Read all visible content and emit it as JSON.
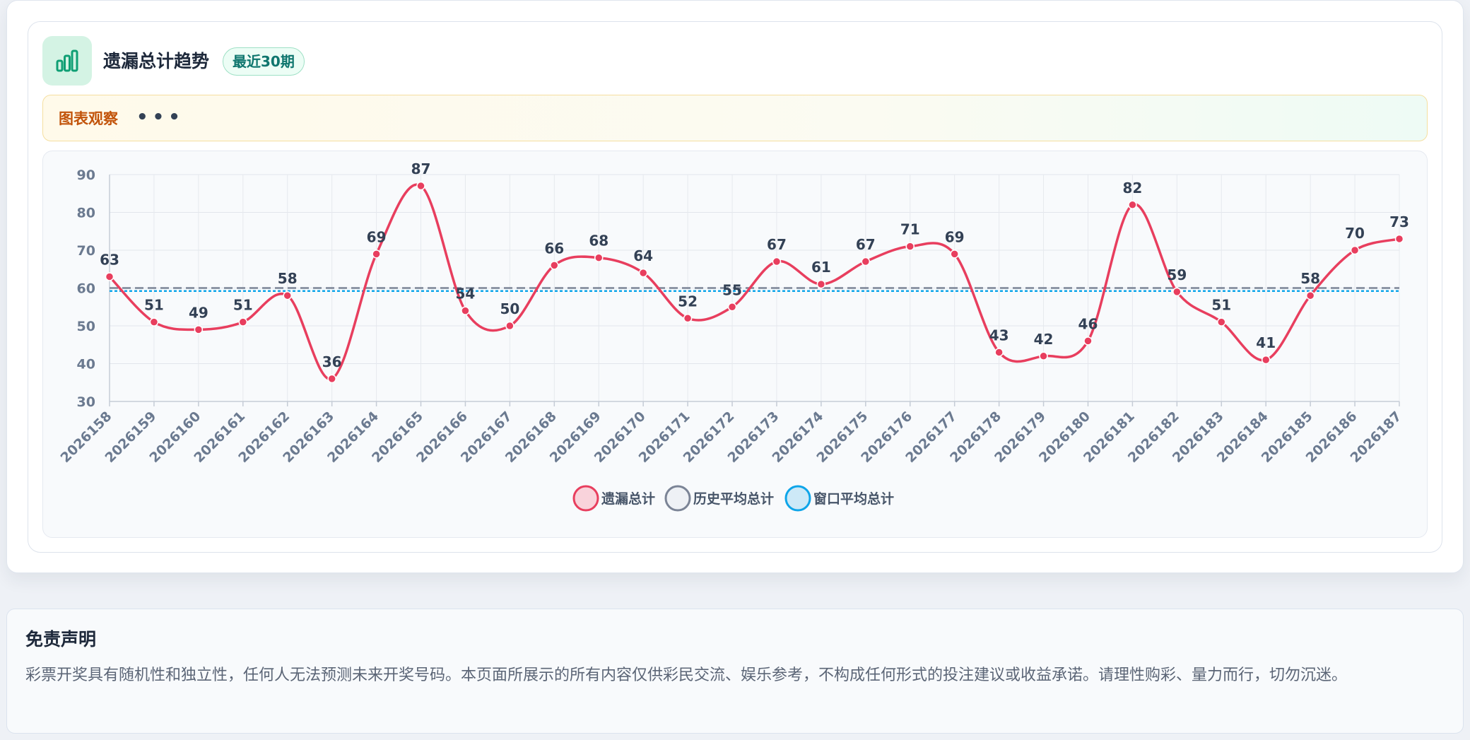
{
  "header": {
    "title": "遗漏总计趋势",
    "badge": "最近30期",
    "icon": "bar-chart-icon"
  },
  "insight": {
    "label": "图表观察",
    "dots": "•••"
  },
  "colors": {
    "series_main": "#e83e5e",
    "history_avg": "#7b8496",
    "window_avg": "#0ea5e9",
    "accent_green": "#0f766e"
  },
  "chart_data": {
    "type": "line",
    "x": [
      "2026158",
      "2026159",
      "2026160",
      "2026161",
      "2026162",
      "2026163",
      "2026164",
      "2026165",
      "2026166",
      "2026167",
      "2026168",
      "2026169",
      "2026170",
      "2026171",
      "2026172",
      "2026173",
      "2026174",
      "2026175",
      "2026176",
      "2026177",
      "2026178",
      "2026179",
      "2026180",
      "2026181",
      "2026182",
      "2026183",
      "2026184",
      "2026185",
      "2026186",
      "2026187"
    ],
    "series": [
      {
        "name": "遗漏总计",
        "values": [
          63,
          51,
          49,
          51,
          58,
          36,
          69,
          87,
          54,
          50,
          66,
          68,
          64,
          52,
          55,
          67,
          61,
          67,
          71,
          69,
          43,
          42,
          46,
          82,
          59,
          51,
          41,
          58,
          70,
          73
        ],
        "color": "#e83e5e",
        "smooth": true,
        "data_labels": true
      },
      {
        "name": "历史平均总计",
        "value": 60,
        "style": "dashed",
        "color": "#7b8496"
      },
      {
        "name": "窗口平均总计",
        "value": 59.2,
        "style": "dotted",
        "color": "#0ea5e9"
      }
    ],
    "yticks": [
      "30",
      "40",
      "50",
      "60",
      "70",
      "80",
      "90"
    ],
    "ylim": [
      30,
      90
    ],
    "grid": true,
    "legend": "bottom-center"
  },
  "disclaimer": {
    "title": "免责声明",
    "text": "彩票开奖具有随机性和独立性，任何人无法预测未来开奖号码。本页面所展示的所有内容仅供彩民交流、娱乐参考，不构成任何形式的投注建议或收益承诺。请理性购彩、量力而行，切勿沉迷。"
  }
}
